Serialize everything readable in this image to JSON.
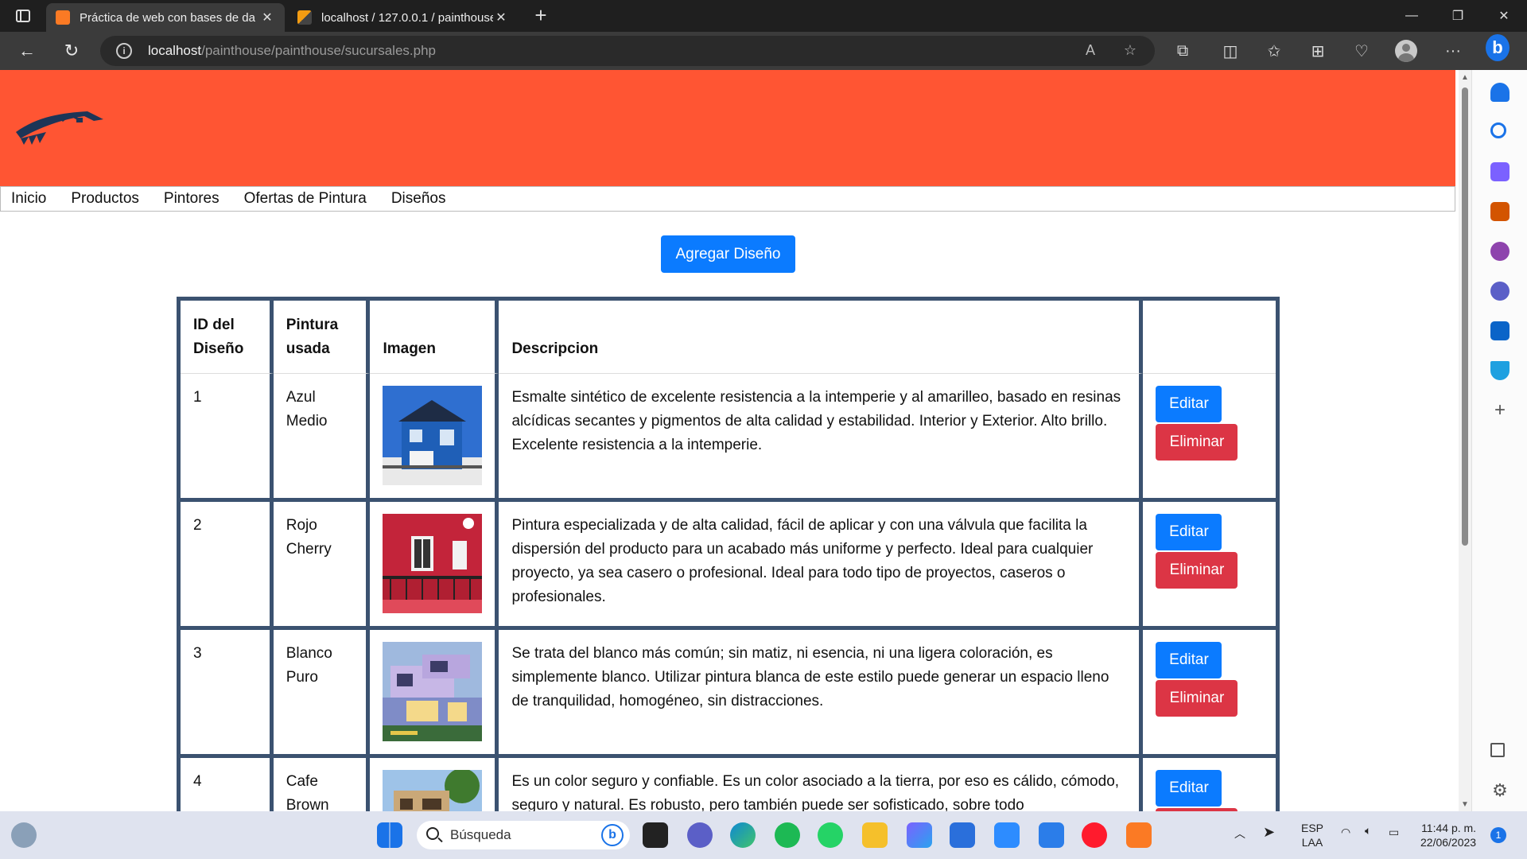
{
  "browser": {
    "tabs": [
      {
        "title": "Práctica de web con bases de da",
        "active": true
      },
      {
        "title": "localhost / 127.0.0.1 / painthouse",
        "active": false
      }
    ],
    "address": {
      "host": "localhost",
      "path": "/painthouse/painthouse/sucursales.php"
    }
  },
  "nav": {
    "items": [
      "Inicio",
      "Productos",
      "Pintores",
      "Ofertas de Pintura",
      "Diseños"
    ]
  },
  "add_button": "Agregar Diseño",
  "table": {
    "headers": [
      "ID del Diseño",
      "Pintura usada",
      "Imagen",
      "Descripcion",
      ""
    ],
    "rows": [
      {
        "id": "1",
        "paint": "Azul Medio",
        "image": "house-blue",
        "desc": "Esmalte sintético de excelente resistencia a la intemperie y al amarilleo, basado en resinas alcídicas secantes y pigmentos de alta calidad y estabilidad. Interior y Exterior. Alto brillo. Excelente resistencia a la intemperie."
      },
      {
        "id": "2",
        "paint": "Rojo Cherry",
        "image": "house-red",
        "desc": "Pintura especializada y de alta calidad, fácil de aplicar y con una válvula que facilita la dispersión del producto para un acabado más uniforme y perfecto. Ideal para cualquier proyecto, ya sea casero o profesional. Ideal para todo tipo de proyectos, caseros o profesionales."
      },
      {
        "id": "3",
        "paint": "Blanco Puro",
        "image": "house-white",
        "desc": "Se trata del blanco más común; sin matiz, ni esencia, ni una ligera coloración, es simplemente blanco. Utilizar pintura blanca de este estilo puede generar un espacio lleno de tranquilidad, homogéneo, sin distracciones."
      },
      {
        "id": "4",
        "paint": "Cafe Brown",
        "image": "house-brown",
        "desc": "Es un color seguro y confiable. Es un color asociado a la tierra, por eso es cálido, cómodo, seguro y natural. Es robusto, pero también puede ser sofisticado, sobre todo"
      }
    ],
    "edit_label": "Editar",
    "delete_label": "Eliminar"
  },
  "taskbar": {
    "search_placeholder": "Búsqueda",
    "lang1": "ESP",
    "lang2": "LAA",
    "time": "11:44 p. m.",
    "date": "22/06/2023",
    "notif_count": "1"
  },
  "colors": {
    "hero": "#ff5533",
    "primary": "#0b7bff",
    "danger": "#dc3545",
    "table_border": "#3b5270"
  }
}
